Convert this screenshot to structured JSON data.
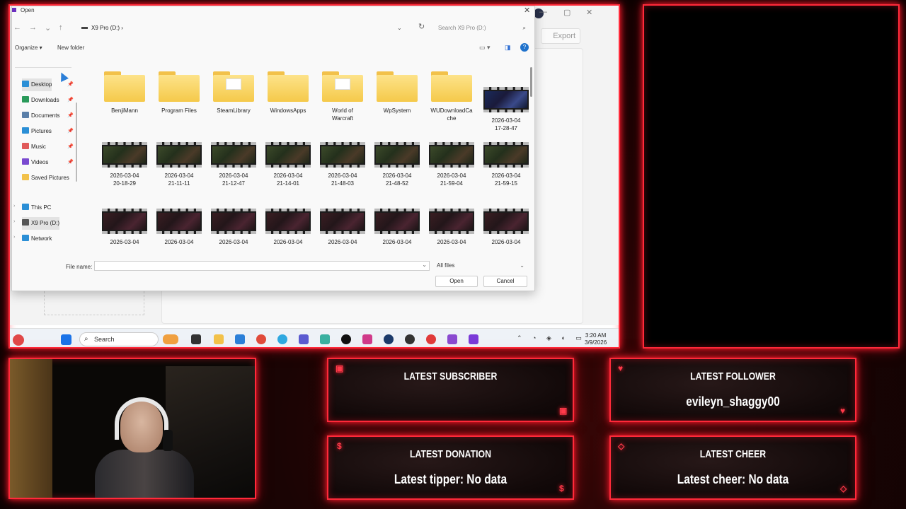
{
  "dialog": {
    "title": "Open",
    "address_path": "X9 Pro (D:)  ›",
    "search_placeholder": "Search X9 Pro (D:)",
    "organize_label": "Organize ▾",
    "new_folder_label": "New folder",
    "help_label": "?",
    "nav": {
      "quick": [
        {
          "label": "Desktop",
          "color": "#2b8fd6"
        },
        {
          "label": "Downloads",
          "color": "#2a9a5a"
        },
        {
          "label": "Documents",
          "color": "#5a7fa8"
        },
        {
          "label": "Pictures",
          "color": "#2b8fd6"
        },
        {
          "label": "Music",
          "color": "#e05a5a"
        },
        {
          "label": "Videos",
          "color": "#7a4ad0"
        },
        {
          "label": "Saved Pictures",
          "color": "#f2c14a"
        }
      ],
      "drives": [
        {
          "label": "This PC",
          "color": "#2b8fd6"
        },
        {
          "label": "X9 Pro (D:)",
          "color": "#555555"
        },
        {
          "label": "Network",
          "color": "#2b8fd6"
        }
      ]
    },
    "folders": [
      "BenjiMann",
      "Program Files",
      "SteamLibrary",
      "WindowsApps",
      "World of\nWarcraft",
      "WpSystem",
      "WUDownloadCa\nche"
    ],
    "first_video": "2026-03-04\n17-28-47",
    "videos_row2": [
      "2026-03-04\n20-18-29",
      "2026-03-04\n21-11-11",
      "2026-03-04\n21-12-47",
      "2026-03-04\n21-14-01",
      "2026-03-04\n21-48-03",
      "2026-03-04\n21-48-52",
      "2026-03-04\n21-59-04",
      "2026-03-04\n21-59-15"
    ],
    "videos_row3": [
      "2026-03-04",
      "2026-03-04",
      "2026-03-04",
      "2026-03-04",
      "2026-03-04",
      "2026-03-04",
      "2026-03-04",
      "2026-03-04"
    ],
    "file_name_label": "File name:",
    "file_name_value": "",
    "file_type": "All files",
    "open_label": "Open",
    "cancel_label": "Cancel"
  },
  "background_app": {
    "export_label": "Export"
  },
  "taskbar": {
    "search_label": "Search",
    "time": "3:20 AM",
    "date": "3/9/2026",
    "tray": "⌃ ◔ ◈ ◐ ▭"
  },
  "overlay": {
    "subscriber": {
      "title": "LATEST SUBSCRIBER",
      "value": "",
      "icon": "▣"
    },
    "follower": {
      "title": "LATEST FOLLOWER",
      "value": "evileyn_shaggy00",
      "icon": "♥"
    },
    "donation": {
      "title": "LATEST DONATION",
      "value": "Latest tipper: No data",
      "icon": "$"
    },
    "cheer": {
      "title": "LATEST CHEER",
      "value": "Latest cheer: No data",
      "icon": "◇"
    }
  }
}
